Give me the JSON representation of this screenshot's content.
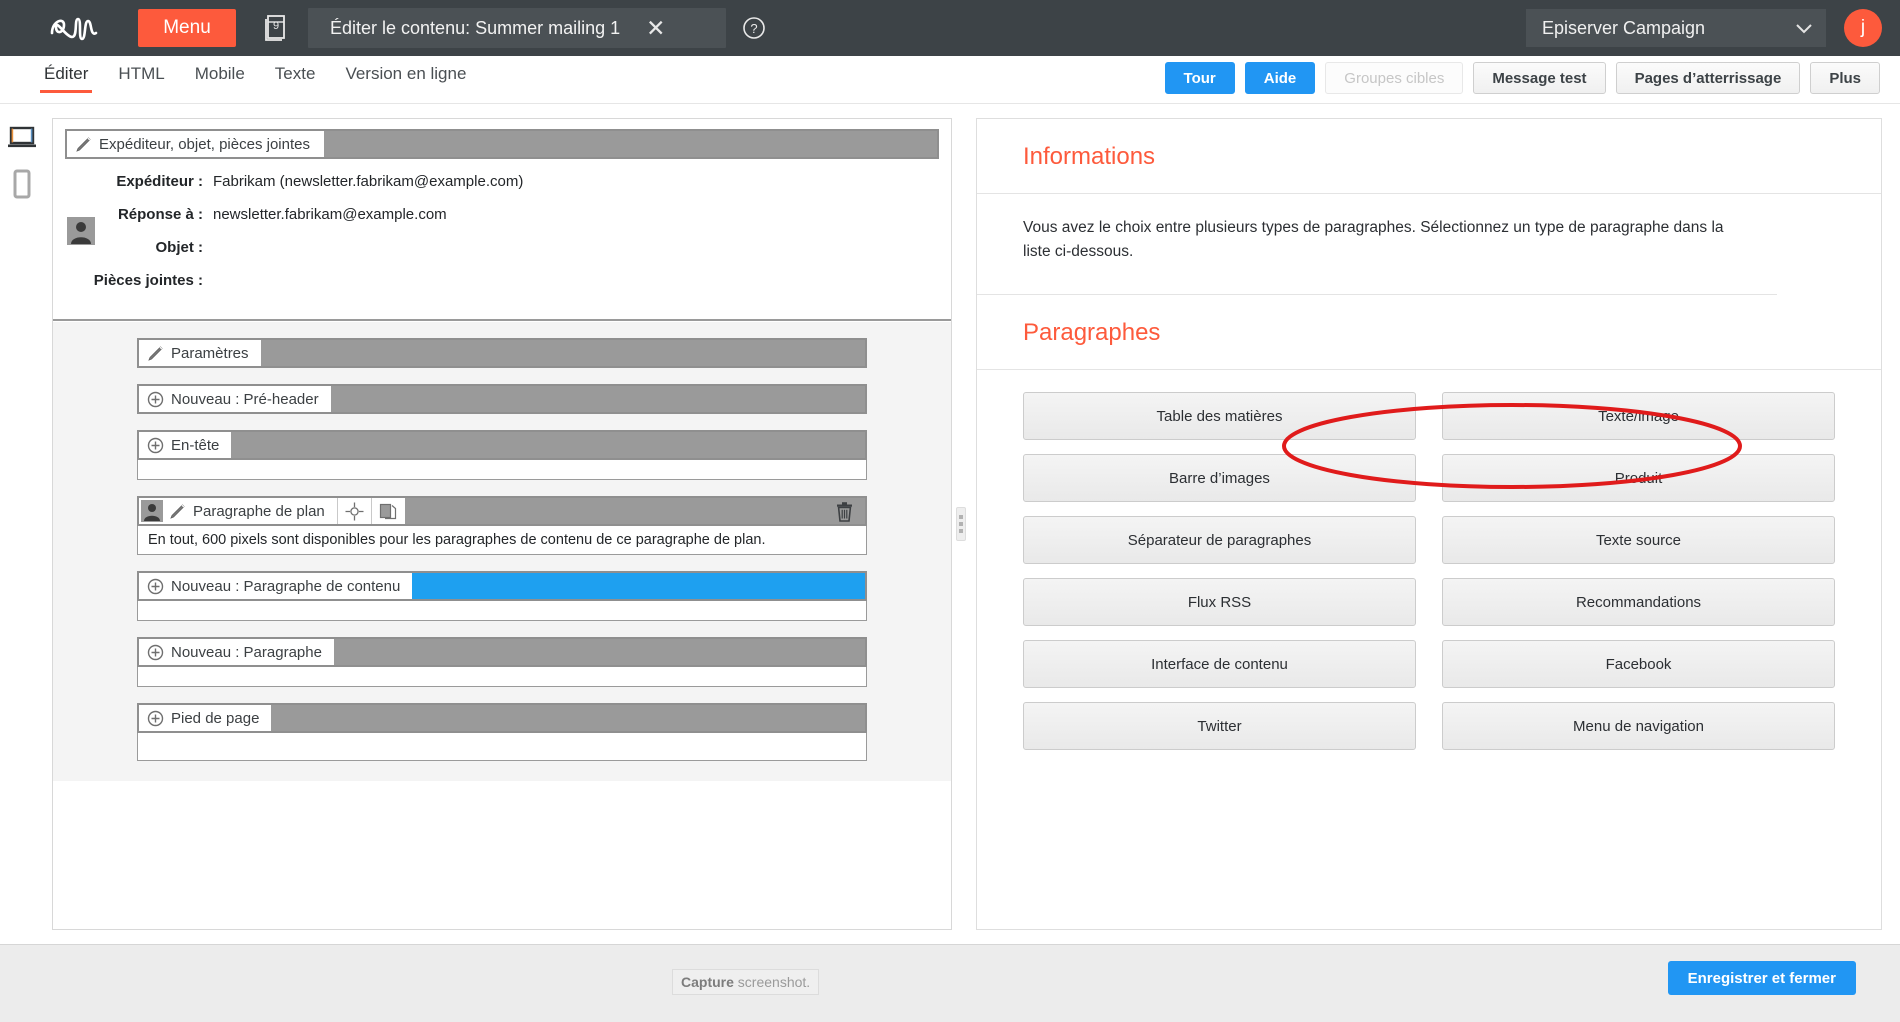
{
  "topbar": {
    "logo": "epi-logo",
    "menu_label": "Menu",
    "docs_badge": "9",
    "title": "Éditer le contenu: Summer mailing 1",
    "close_label": "✕",
    "help_label": "?",
    "app_selector": "Episerver Campaign",
    "avatar_initial": "j"
  },
  "tabs": [
    {
      "label": "Éditer",
      "active": true
    },
    {
      "label": "HTML",
      "active": false
    },
    {
      "label": "Mobile",
      "active": false
    },
    {
      "label": "Texte",
      "active": false
    },
    {
      "label": "Version en ligne",
      "active": false
    }
  ],
  "toolbar_buttons": [
    {
      "label": "Tour",
      "style": "primary"
    },
    {
      "label": "Aide",
      "style": "primary"
    },
    {
      "label": "Groupes cibles",
      "style": "disabled"
    },
    {
      "label": "Message test",
      "style": "normal"
    },
    {
      "label": "Pages d’atterrissage",
      "style": "normal"
    },
    {
      "label": "Plus",
      "style": "normal"
    }
  ],
  "device_rail": [
    {
      "icon": "desktop-preview-icon",
      "active": true
    },
    {
      "icon": "mobile-preview-icon",
      "active": false
    }
  ],
  "editor": {
    "sender_header": "Expéditeur, objet, pièces jointes",
    "fields": [
      {
        "label": "Expéditeur :",
        "value": "Fabrikam (newsletter.fabrikam@example.com)"
      },
      {
        "label": "Réponse à :",
        "value": "newsletter.fabrikam@example.com"
      },
      {
        "label": "Objet :",
        "value": ""
      },
      {
        "label": "Pièces jointes :",
        "value": ""
      }
    ],
    "rows": [
      {
        "label": "Paramètres",
        "icon": "pencil-icon",
        "fill": "grey"
      },
      {
        "label": "Nouveau : Pré-header",
        "icon": "plus-icon",
        "fill": "grey"
      },
      {
        "label": "En-tête",
        "icon": "plus-icon",
        "fill": "grey"
      },
      {
        "label": "Paragraphe de plan",
        "icon": "pencil-icon",
        "fill": "grey",
        "note": "En tout, 600 pixels sont disponibles pour les paragraphes de contenu de ce paragraphe de plan."
      },
      {
        "label": "Nouveau : Paragraphe de contenu",
        "icon": "plus-icon",
        "fill": "blue"
      },
      {
        "label": "Nouveau : Paragraphe",
        "icon": "plus-icon",
        "fill": "grey"
      },
      {
        "label": "Pied de page",
        "icon": "plus-icon",
        "fill": "grey"
      }
    ]
  },
  "right_panel": {
    "info_title": "Informations",
    "info_text": "Vous avez le choix entre plusieurs types de paragraphes. Sélectionnez un type de paragraphe dans la liste ci-dessous.",
    "paragraphs_title": "Paragraphes",
    "paragraph_types": [
      "Table des matières",
      "Texte/image",
      "Barre d’images",
      "Produit",
      "Séparateur de paragraphes",
      "Texte source",
      "Flux RSS",
      "Recommandations",
      "Interface de contenu",
      "Facebook",
      "Twitter",
      "Menu de navigation"
    ],
    "highlighted_type": "Produit"
  },
  "bottom": {
    "capture_bold": "Capture",
    "capture_rest": " screenshot.",
    "save_label": "Enregistrer et fermer"
  },
  "colors": {
    "brand_red": "#fd5a3c",
    "topbar_dark": "#3d4347",
    "accent_blue": "#2196f3",
    "row_blue": "#1ea0f0",
    "annotation_red": "#e01b1b"
  }
}
